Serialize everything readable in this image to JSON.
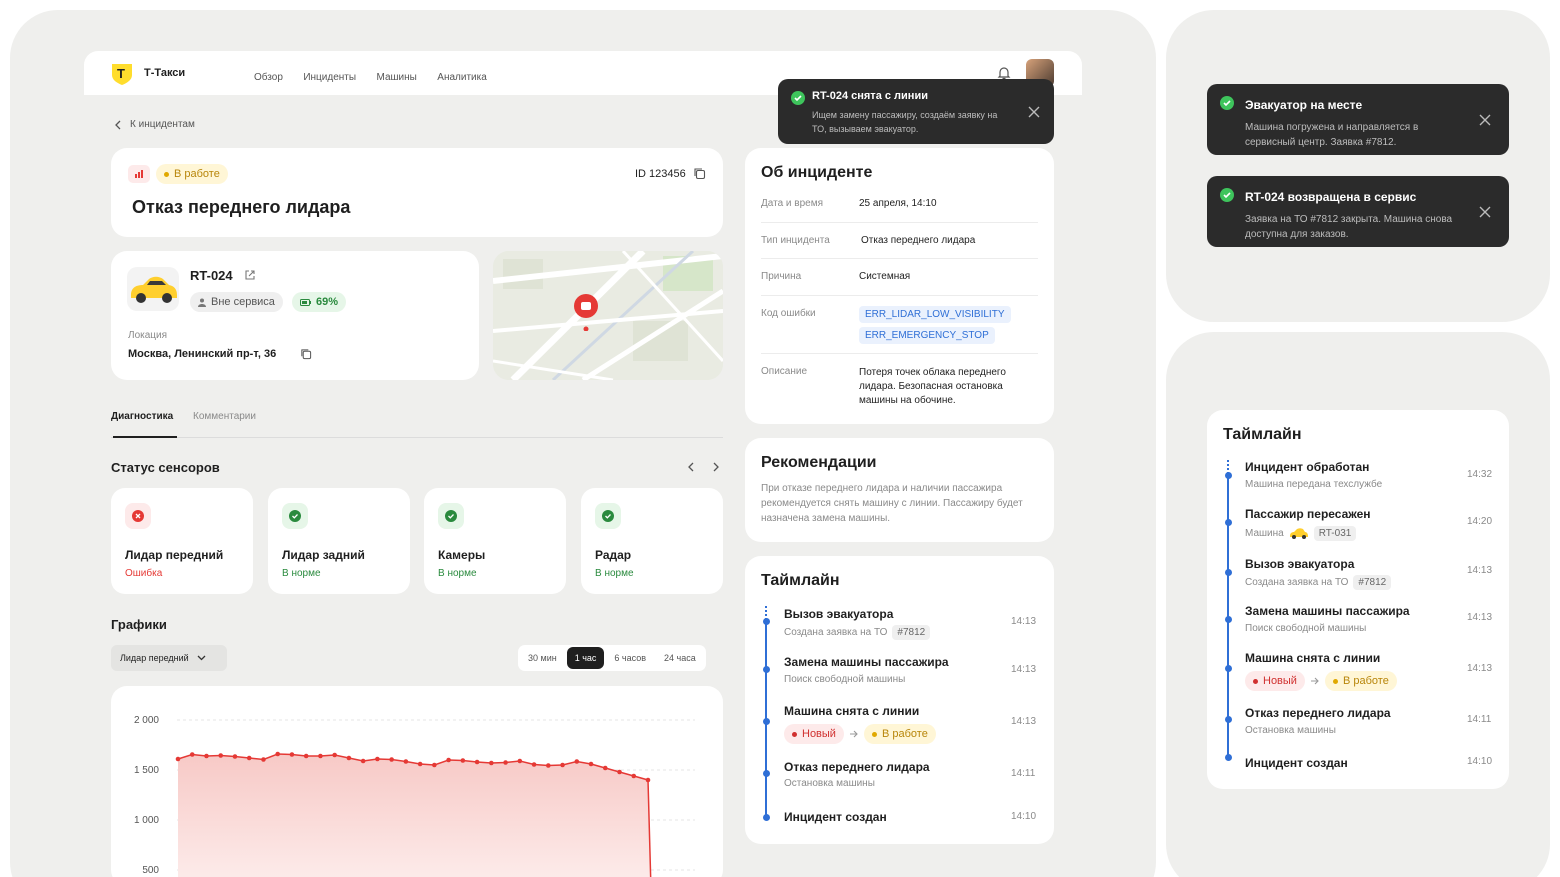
{
  "header": {
    "brand": "Т-Такси",
    "logo_letter": "T",
    "nav": [
      "Обзор",
      "Инциденты",
      "Машины",
      "Аналитика"
    ]
  },
  "toasts_main": {
    "title": "RT-024 снята с линии",
    "text": "Ищем замену пассажиру, создаём заявку на ТО, вызываем эвакуатор."
  },
  "toasts_side": [
    {
      "title": "Эвакуатор на месте",
      "text": "Машина погружена и направляется в сервисный центр. Заявка #7812."
    },
    {
      "title": "RT-024 возвращена в сервис",
      "text": "Заявка на ТО #7812 закрыта. Машина снова доступна для заказов."
    }
  ],
  "back_link": "К инцидентам",
  "incident": {
    "status": "В работе",
    "id_label": "ID 123456",
    "title": "Отказ переднего лидара"
  },
  "car": {
    "name": "RT-024",
    "service_status": "Вне сервиса",
    "battery": "69%",
    "location_label": "Локация",
    "location": "Москва, Ленинский пр-т, 36"
  },
  "tabs": [
    "Диагностика",
    "Комментарии"
  ],
  "sensors": {
    "title": "Статус сенсоров",
    "items": [
      {
        "name": "Лидар передний",
        "status": "Ошибка",
        "state": "error"
      },
      {
        "name": "Лидар задний",
        "status": "В норме",
        "state": "ok"
      },
      {
        "name": "Камеры",
        "status": "В норме",
        "state": "ok"
      },
      {
        "name": "Радар",
        "status": "В норме",
        "state": "ok"
      }
    ]
  },
  "charts": {
    "title": "Графики",
    "select": "Лидар передний",
    "ranges": [
      "30 мин",
      "1 час",
      "6 часов",
      "24 часа"
    ],
    "active_range": "1 час"
  },
  "chart_data": {
    "type": "area",
    "title": "",
    "xlabel": "",
    "ylabel": "",
    "y_ticks": [
      "2 000",
      "1 500",
      "1 000",
      "500"
    ],
    "ylim": [
      0,
      2000
    ],
    "x": [
      1,
      2,
      3,
      4,
      5,
      6,
      7,
      8,
      9,
      10,
      11,
      12,
      13,
      14,
      15,
      16,
      17,
      18,
      19,
      20,
      21,
      22,
      23,
      24,
      25,
      26,
      27,
      28,
      29,
      30,
      31,
      32,
      33,
      34,
      35
    ],
    "values": [
      1610,
      1655,
      1640,
      1645,
      1635,
      1620,
      1605,
      1660,
      1655,
      1640,
      1640,
      1650,
      1620,
      1590,
      1610,
      1605,
      1585,
      1560,
      1550,
      1600,
      1595,
      1580,
      1570,
      1575,
      1590,
      1555,
      1545,
      1550,
      1585,
      1560,
      1520,
      1480,
      1440,
      1400,
      300
    ],
    "color": "#e53935"
  },
  "about": {
    "title": "Об инциденте",
    "rows": [
      {
        "label": "Дата и время",
        "value": "25 апреля, 14:10"
      },
      {
        "label": "Тип инцидента",
        "value": "Отказ переднего лидара"
      },
      {
        "label": "Причина",
        "value": "Системная"
      },
      {
        "label": "Код ошибки",
        "codes": [
          "ERR_LIDAR_LOW_VISIBILITY",
          "ERR_EMERGENCY_STOP"
        ]
      },
      {
        "label": "Описание",
        "value": "Потеря точек облака переднего лидара. Безопасная остановка машины на обочине."
      }
    ]
  },
  "recommend": {
    "title": "Рекомендации",
    "text": "При отказе переднего лидара и наличии пассажира рекомендуется снять машину с линии. Пассажиру будет назначена замена машины."
  },
  "timeline_main": {
    "title": "Таймлайн",
    "items": [
      {
        "title": "Вызов эвакуатора",
        "sub": "Создана заявка на ТО",
        "tag": "#7812",
        "time": "14:13"
      },
      {
        "title": "Замена машины пассажира",
        "sub": "Поиск свободной машины",
        "time": "14:13"
      },
      {
        "title": "Машина снята с линии",
        "from": "Новый",
        "to": "В работе",
        "time": "14:13"
      },
      {
        "title": "Отказ переднего лидара",
        "sub": "Остановка машины",
        "time": "14:11"
      },
      {
        "title": "Инцидент создан",
        "time": "14:10"
      }
    ]
  },
  "timeline_side": {
    "title": "Таймлайн",
    "items": [
      {
        "title": "Инцидент обработан",
        "sub": "Машина передана техслужбе",
        "time": "14:32"
      },
      {
        "title": "Пассажир пересажен",
        "sub": "Машина",
        "tag": "RT-031",
        "time": "14:20"
      },
      {
        "title": "Вызов эвакуатора",
        "sub": "Создана заявка на ТО",
        "tag": "#7812",
        "time": "14:13"
      },
      {
        "title": "Замена машины пассажира",
        "sub": "Поиск свободной машины",
        "time": "14:13"
      },
      {
        "title": "Машина снята с линии",
        "from": "Новый",
        "to": "В работе",
        "time": "14:13"
      },
      {
        "title": "Отказ переднего лидара",
        "sub": "Остановка машины",
        "time": "14:11"
      },
      {
        "title": "Инцидент создан",
        "time": "14:10"
      }
    ]
  },
  "colors": {
    "accent": "#2f6fd6",
    "brand": "#ffdd2d",
    "error": "#e53935",
    "ok": "#2a8a3e"
  }
}
